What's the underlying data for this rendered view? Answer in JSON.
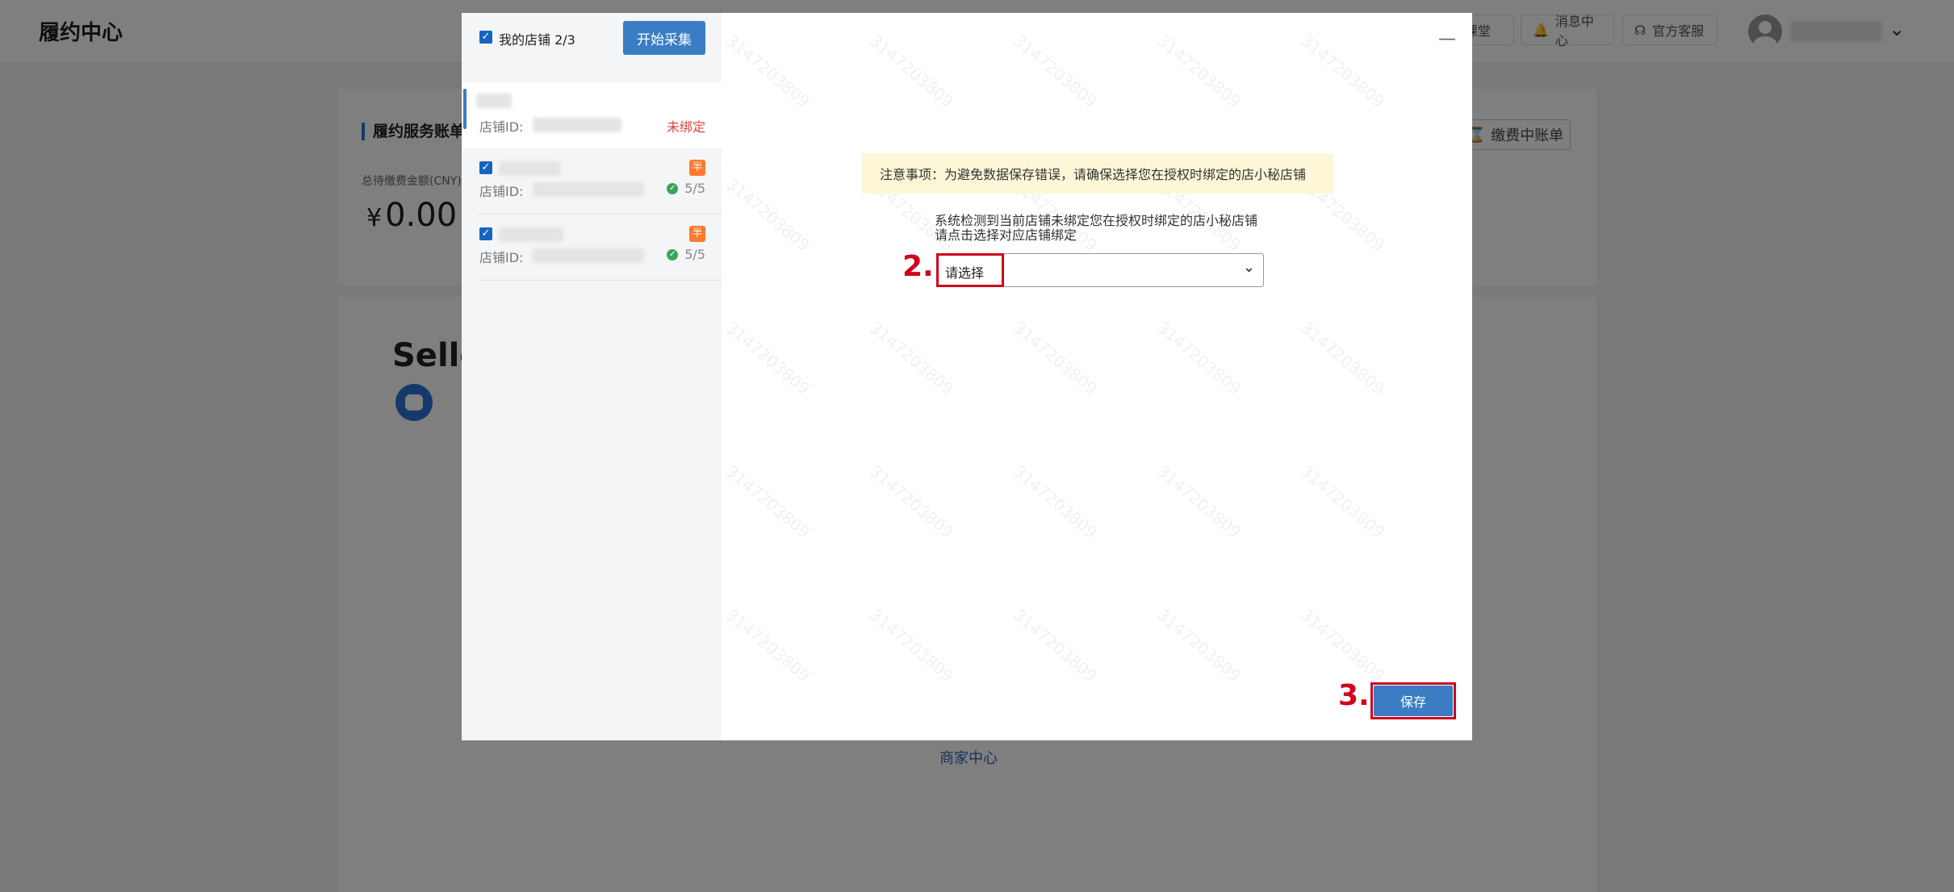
{
  "app": {
    "title": "履约中心"
  },
  "topbar": {
    "ketang_label": "课堂",
    "messages_label": "消息中心",
    "service_label": "官方客服"
  },
  "account": {
    "title": "履约服务账单",
    "total_label": "总待缴费金额(CNY)",
    "currency_symbol": "¥",
    "amount": "0.00",
    "bill_button": "缴费中账单"
  },
  "seller": {
    "title": "Selle"
  },
  "footer": {
    "merchant_link": "商家中心"
  },
  "modal": {
    "my_stores_label": "我的店铺",
    "store_count": "2/3",
    "start_collect_button": "开始采集",
    "shops": [
      {
        "id_label": "店铺ID:",
        "status": "未绑定"
      },
      {
        "id_label": "店铺ID:",
        "badge": "半",
        "progress": "5/5"
      },
      {
        "id_label": "店铺ID:",
        "badge": "半",
        "progress": "5/5"
      }
    ],
    "notice": "注意事项：为避免数据保存错误，请确保选择您在授权时绑定的店小秘店铺",
    "detect_line1": "系统检测到当前店铺未绑定您在授权时绑定的店小秘店铺",
    "detect_line2": "请点击选择对应店铺绑定",
    "select_placeholder": "请选择",
    "step2_label": "2.",
    "step3_label": "3.",
    "save_button": "保存",
    "watermark": "3147203809"
  }
}
